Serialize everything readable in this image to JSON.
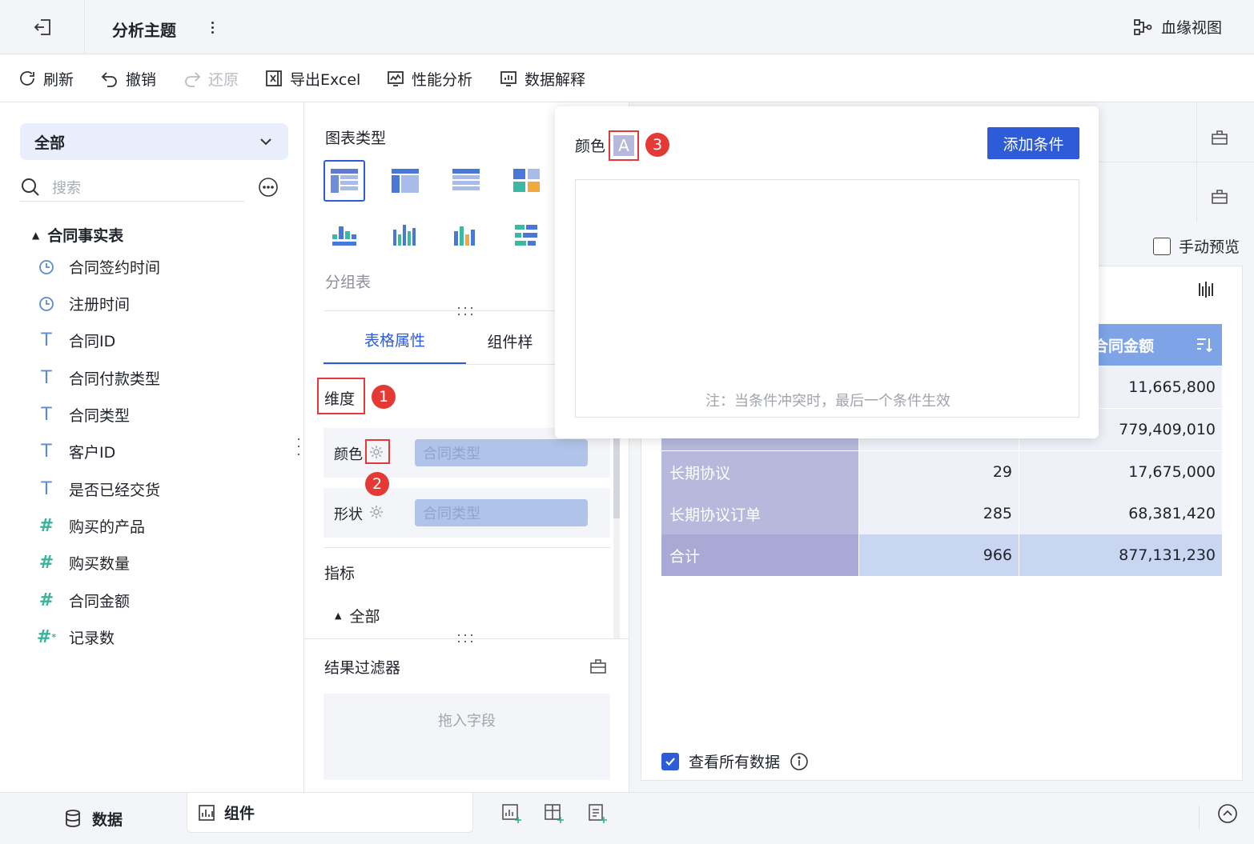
{
  "header": {
    "title": "分析主题",
    "lineage_label": "血缘视图"
  },
  "toolbar": {
    "refresh": "刷新",
    "undo": "撤销",
    "redo": "还原",
    "export": "导出Excel",
    "perf": "性能分析",
    "explain": "数据解释"
  },
  "left": {
    "dropdown": "全部",
    "search_placeholder": "搜索",
    "table_name": "合同事实表",
    "fields": [
      {
        "label": "合同签约时间",
        "icon": "clock-icon"
      },
      {
        "label": "注册时间",
        "icon": "clock-icon"
      },
      {
        "label": "合同ID",
        "icon": "text-type-icon"
      },
      {
        "label": "合同付款类型",
        "icon": "text-type-icon"
      },
      {
        "label": "合同类型",
        "icon": "text-type-icon"
      },
      {
        "label": "客户ID",
        "icon": "text-type-icon"
      },
      {
        "label": "是否已经交货",
        "icon": "text-type-icon"
      },
      {
        "label": "购买的产品",
        "icon": "number-type-icon"
      },
      {
        "label": "购买数量",
        "icon": "number-type-icon"
      },
      {
        "label": "合同金额",
        "icon": "number-type-icon"
      },
      {
        "label": "记录数",
        "icon": "number-type-icon"
      }
    ]
  },
  "mid": {
    "chart_type_label": "图表类型",
    "chart_type_name": "分组表",
    "tab_table": "表格属性",
    "tab_component": "组件样",
    "dimension_label": "维度",
    "color_label": "颜色",
    "shape_label": "形状",
    "color_field": "合同类型",
    "shape_field": "合同类型",
    "metric_label": "指标",
    "all_label": "全部",
    "filter_label": "结果过滤器",
    "drop_hint": "拖入字段"
  },
  "markers": [
    "1",
    "2",
    "3"
  ],
  "popup": {
    "title": "颜色",
    "swatch": "A",
    "add_button": "添加条件",
    "note": "注：当条件冲突时，最后一个条件生效"
  },
  "right": {
    "manual_preview": "手动预览",
    "header_amount": "合同金额",
    "rows": [
      {
        "name": "",
        "count": "",
        "amount": "11,665,800"
      },
      {
        "name": "",
        "count": "",
        "amount": "779,409,010"
      },
      {
        "name": "长期协议",
        "count": "29",
        "amount": "17,675,000"
      },
      {
        "name": "长期协议订单",
        "count": "285",
        "amount": "68,381,420"
      }
    ],
    "total": {
      "name": "合计",
      "count": "966",
      "amount": "877,131,230"
    },
    "view_all": "查看所有数据"
  },
  "bottom": {
    "data_tab": "数据",
    "component_tab": "组件"
  },
  "colors": {
    "accent": "#2e5bd7",
    "dim_cell": "#b7b9dc",
    "value_cell": "#eef1f8",
    "total_value": "#c9d6f1",
    "header_blue": "#7ea3e6",
    "marker_red": "#e53935"
  }
}
